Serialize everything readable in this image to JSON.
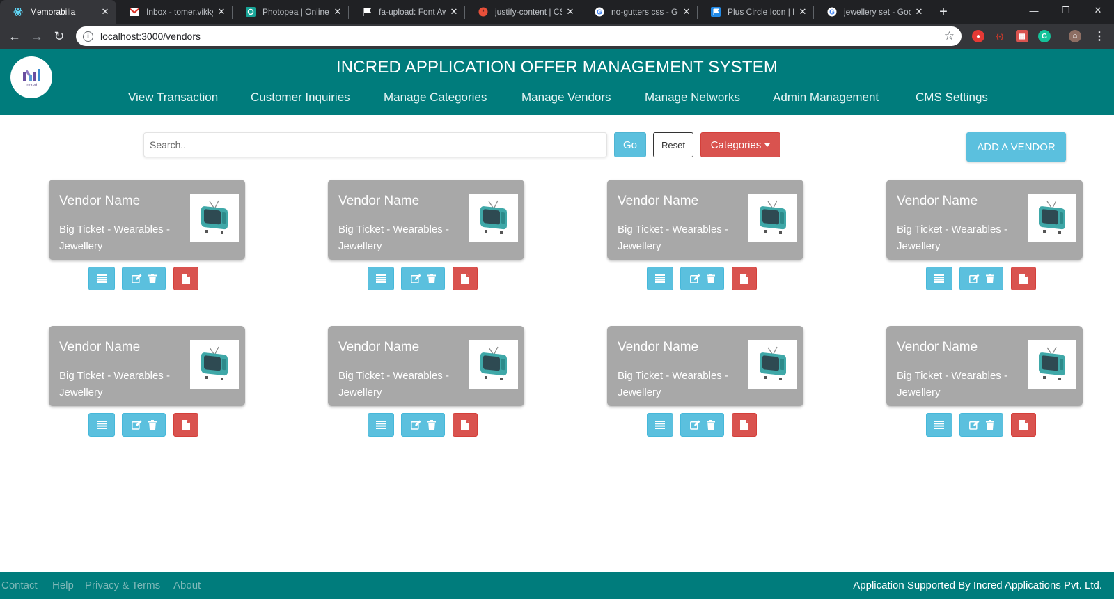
{
  "browser": {
    "tabs": [
      {
        "label": "Memorabilia",
        "icon": "react-icon",
        "active": true
      },
      {
        "label": "Inbox - tomer.vikky",
        "icon": "gmail-icon"
      },
      {
        "label": "Photopea | Online P",
        "icon": "photopea-icon"
      },
      {
        "label": "fa-upload: Font Awe",
        "icon": "flag-icon"
      },
      {
        "label": "justify-content | CSS",
        "icon": "css-tricks-icon"
      },
      {
        "label": "no-gutters css - Goo",
        "icon": "google-icon"
      },
      {
        "label": "Plus Circle Icon | For",
        "icon": "fontawesome-flag-icon"
      },
      {
        "label": "jewellery set - Goog",
        "icon": "google-icon"
      }
    ],
    "url": "localhost:3000/vendors"
  },
  "header": {
    "logo_text": "Incred",
    "title": "INCRED APPLICATION OFFER MANAGEMENT SYSTEM",
    "nav": [
      "View Transaction",
      "Customer Inquiries",
      "Manage Categories",
      "Manage Vendors",
      "Manage Networks",
      "Admin Management",
      "CMS Settings"
    ]
  },
  "toolbar": {
    "search_placeholder": "Search..",
    "go_label": "Go",
    "reset_label": "Reset",
    "categories_label": "Categories",
    "add_vendor_label": "ADD A VENDOR"
  },
  "vendors": [
    {
      "name": "Vendor Name",
      "desc": "Big Ticket - Wearables - Jewellery"
    },
    {
      "name": "Vendor Name",
      "desc": "Big Ticket - Wearables - Jewellery"
    },
    {
      "name": "Vendor Name",
      "desc": "Big Ticket - Wearables - Jewellery"
    },
    {
      "name": "Vendor Name",
      "desc": "Big Ticket - Wearables - Jewellery"
    },
    {
      "name": "Vendor Name",
      "desc": "Big Ticket - Wearables - Jewellery"
    },
    {
      "name": "Vendor Name",
      "desc": "Big Ticket - Wearables - Jewellery"
    },
    {
      "name": "Vendor Name",
      "desc": "Big Ticket - Wearables - Jewellery"
    },
    {
      "name": "Vendor Name",
      "desc": "Big Ticket - Wearables - Jewellery"
    }
  ],
  "footer": {
    "links": [
      "Contact",
      "Help",
      "Privacy & Terms",
      "About"
    ],
    "support": "Application Supported By Incred Applications Pvt. Ltd."
  },
  "colors": {
    "header_bg": "#007c7c",
    "info": "#5bc0de",
    "danger": "#d9534f",
    "card_bg": "#a8a8a8"
  }
}
